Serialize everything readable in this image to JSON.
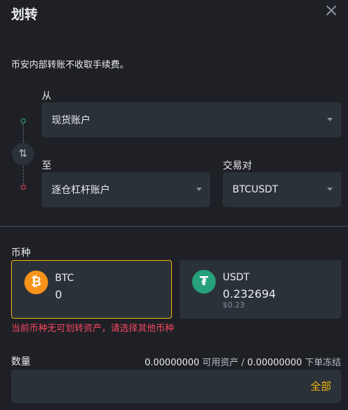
{
  "header": {
    "title": "划转",
    "close_label": "×"
  },
  "notice": "币安内部转账不收取手续费。",
  "from": {
    "label": "从",
    "account": "现货账户"
  },
  "to": {
    "label": "至",
    "account": "逐仓杠杆账户"
  },
  "pair": {
    "label": "交易对",
    "value": "BTCUSDT"
  },
  "swap": {
    "icon_glyph": "⇅"
  },
  "coin": {
    "label": "币种",
    "options": [
      {
        "name": "BTC",
        "amount": "0",
        "icon": "bitcoin-icon",
        "icon_glyph": "₿",
        "color": "#f7931a"
      },
      {
        "name": "USDT",
        "amount": "0.232694",
        "usd": "$0.23",
        "icon": "tether-icon",
        "icon_glyph": "₮",
        "color": "#26a17b"
      }
    ],
    "error": "当前币种无可划转资产，请选择其他币种"
  },
  "quantity": {
    "label": "数量",
    "available": "0.00000000",
    "available_label": "可用资产",
    "separator": "/",
    "frozen": "0.00000000",
    "frozen_label": "下单冻结",
    "all_label": "全部",
    "value": ""
  },
  "colors": {
    "accent": "#f0b90b",
    "error": "#f6465d",
    "background": "#1e2026",
    "field": "#2b3139"
  }
}
